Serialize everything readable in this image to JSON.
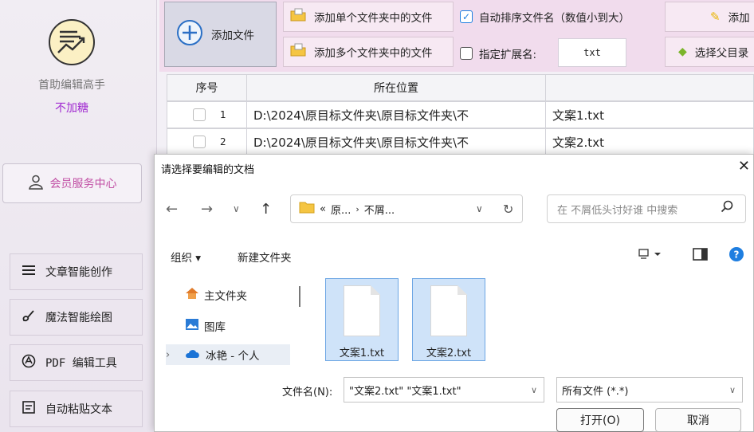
{
  "app": {
    "name": "首助编辑高手",
    "tagline": "不加糖"
  },
  "sidebar": {
    "member_label": "会员服务中心",
    "items": [
      {
        "label": "文章智能创作",
        "icon": "menu-lines-icon"
      },
      {
        "label": "魔法智能绘图",
        "icon": "brush-icon"
      },
      {
        "label": "PDF 编辑工具",
        "icon": "pdf-icon"
      },
      {
        "label": "自动粘贴文本",
        "icon": "paste-icon"
      }
    ]
  },
  "toolbar": {
    "add_file": "添加文件",
    "add_single_folder": "添加单个文件夹中的文件",
    "add_multi_folder": "添加多个文件夹中的文件",
    "auto_sort": "自动排序文件名（数值小到大）",
    "auto_sort_checked": true,
    "specify_ext": "指定扩展名:",
    "specify_ext_checked": false,
    "ext_value": "txt",
    "add_right": "添加",
    "choose_parent": "选择父目录"
  },
  "table": {
    "headers": [
      "序号",
      "所在位置",
      ""
    ],
    "rows": [
      {
        "index": "1",
        "path": "D:\\2024\\原目标文件夹\\原目标文件夹\\不",
        "name": "文案1.txt"
      },
      {
        "index": "2",
        "path": "D:\\2024\\原目标文件夹\\原目标文件夹\\不",
        "name": "文案2.txt"
      }
    ]
  },
  "dialog": {
    "title": "请选择要编辑的文档",
    "breadcrumb_prefix": "«",
    "breadcrumb": [
      "原...",
      "不屑..."
    ],
    "search_placeholder": "在 不屑低头讨好谁 中搜索",
    "organize": "组织 ▾",
    "new_folder": "新建文件夹",
    "tree": [
      {
        "label": "主文件夹",
        "icon": "home-icon"
      },
      {
        "label": "图库",
        "icon": "gallery-icon"
      },
      {
        "label": "冰艳 - 个人",
        "icon": "cloud-icon"
      }
    ],
    "files": [
      "文案1.txt",
      "文案2.txt"
    ],
    "filename_label": "文件名(N):",
    "filename_value": "\"文案2.txt\" \"文案1.txt\"",
    "filetype_value": "所有文件 (*.*)",
    "open_label": "打开(O)",
    "cancel_label": "取消"
  },
  "colors": {
    "accent": "#1e7ee0",
    "brand_purple": "#a12bd1",
    "member_pink": "#c14fa4",
    "toolbar_bg": "#f1dced"
  }
}
